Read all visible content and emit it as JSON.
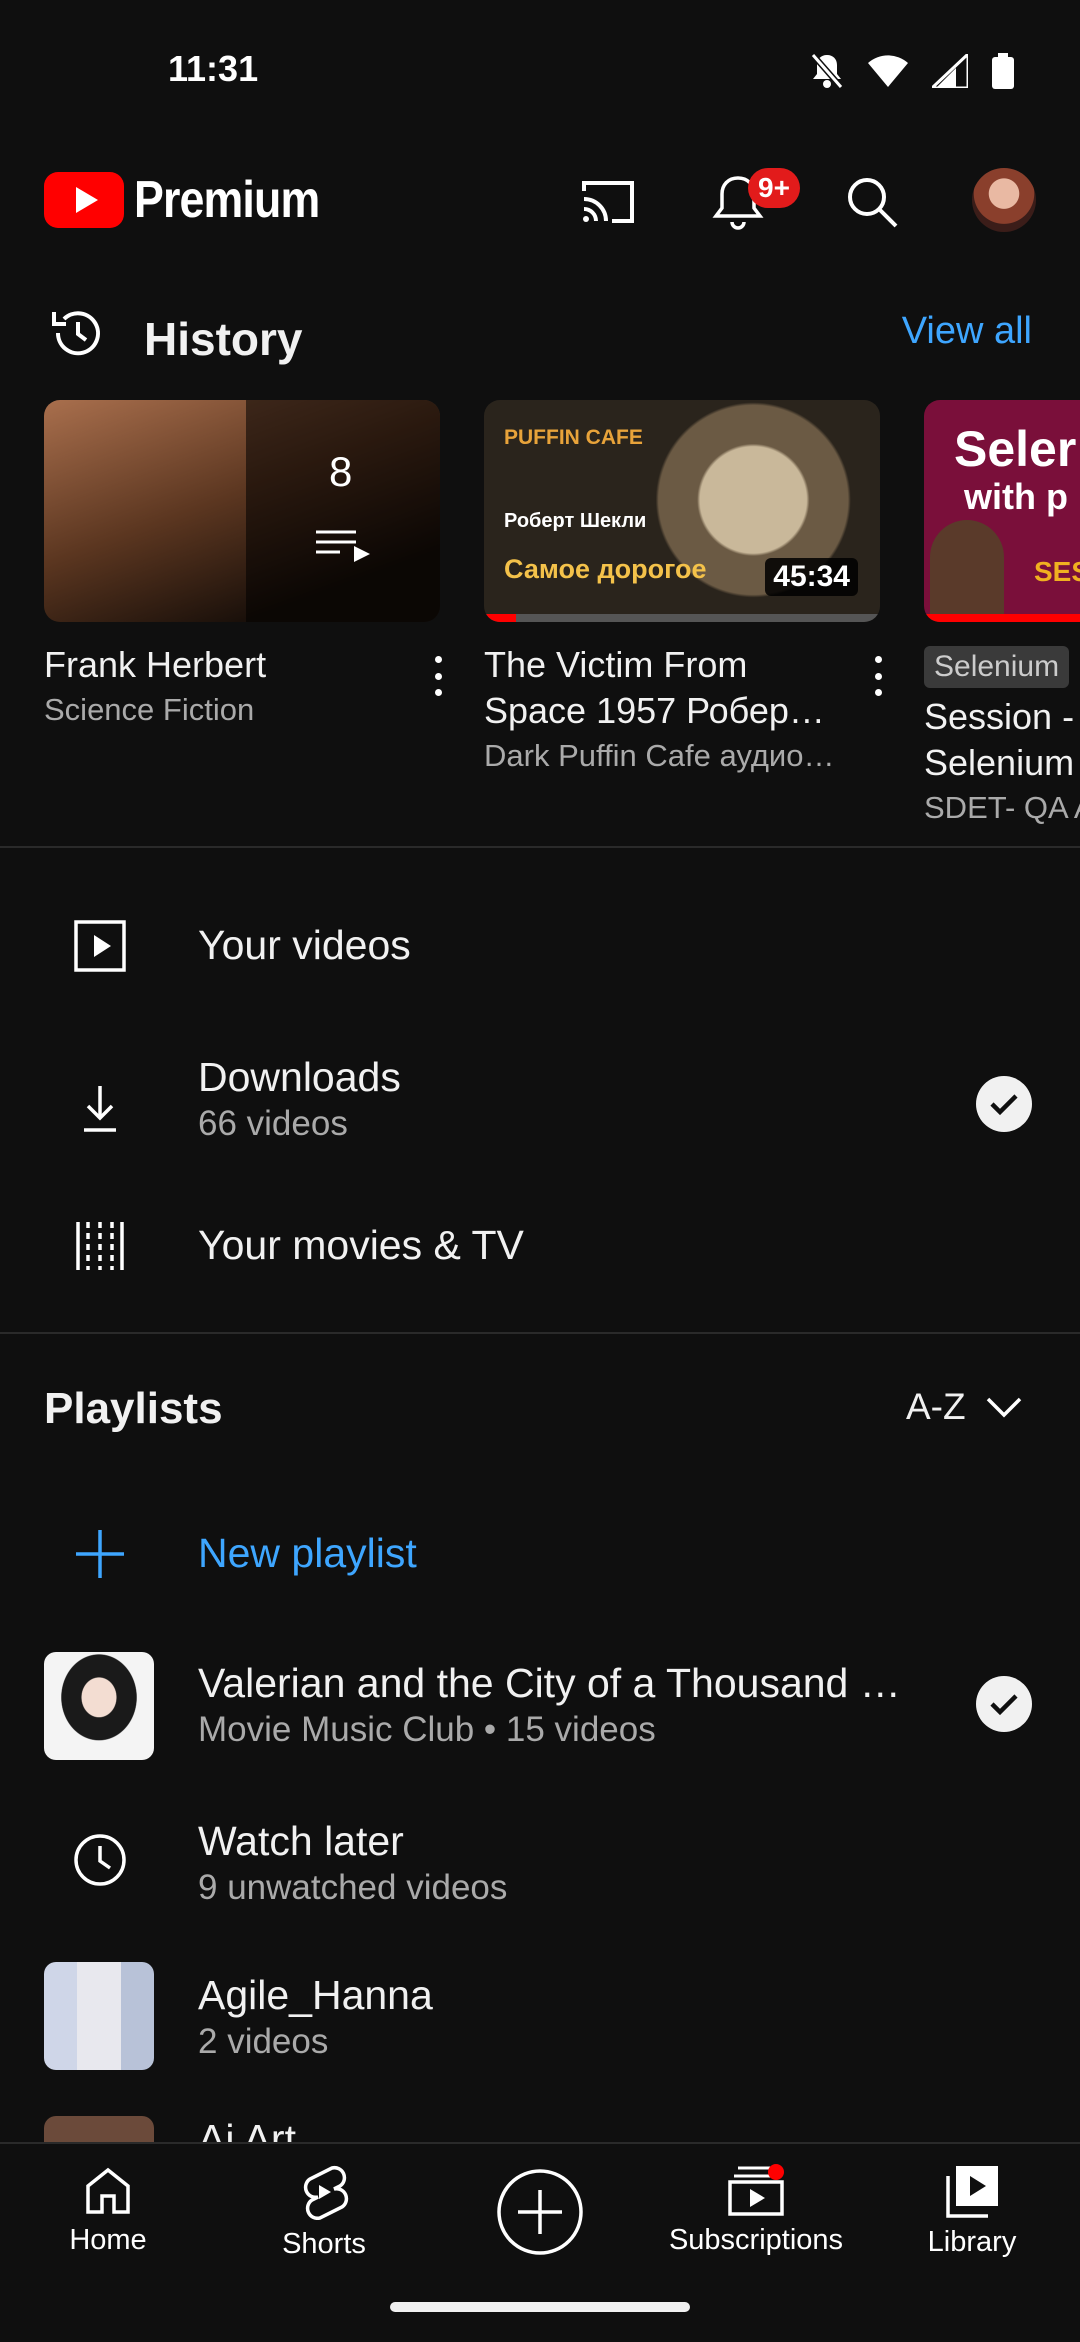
{
  "status_bar": {
    "time": "11:31"
  },
  "header": {
    "brand": "Premium",
    "notification_count": "9+",
    "icons": [
      "cast-icon",
      "bell-icon",
      "search-icon",
      "avatar"
    ]
  },
  "history": {
    "title": "History",
    "view_all": "View all",
    "items": [
      {
        "title": "Frank Herbert",
        "subtitle": "Science Fiction",
        "count": "8"
      },
      {
        "title": "The Victim From Space 1957 Роберт…",
        "title_line1": "The Victim From",
        "title_line2": "Space 1957 Робер…",
        "subtitle": "Dark Puffin Cafe аудио…",
        "duration": "45:34",
        "thumb_brand": "PUFFIN CAFE",
        "thumb_author": "Роберт Шекли",
        "thumb_caption": "Самое дорогое"
      },
      {
        "badge": "Selenium",
        "title_line1": "Session -",
        "title_line2": "Selenium",
        "subtitle": "SDET- QA A",
        "thumb_line1": "Seler",
        "thumb_line2": "with p",
        "thumb_tag": "SES"
      }
    ]
  },
  "library_rows": {
    "your_videos": "Your videos",
    "downloads": "Downloads",
    "downloads_sub": "66 videos",
    "movies": "Your movies & TV"
  },
  "playlists": {
    "title": "Playlists",
    "sort": "A-Z",
    "new_playlist": "New playlist",
    "items": [
      {
        "title": "Valerian and the City of a Thousand …",
        "subtitle": "Movie Music Club • 15 videos"
      },
      {
        "title": "Watch later",
        "subtitle": "9 unwatched videos"
      },
      {
        "title": "Agile_Hanna",
        "subtitle": "2 videos"
      },
      {
        "title": "Ai Art",
        "subtitle": ""
      }
    ]
  },
  "nav": {
    "home": "Home",
    "shorts": "Shorts",
    "subscriptions": "Subscriptions",
    "library": "Library"
  },
  "colors": {
    "accent": "#3ea6ff",
    "brand_red": "#ff0000",
    "badge_red": "#e21b1b"
  }
}
